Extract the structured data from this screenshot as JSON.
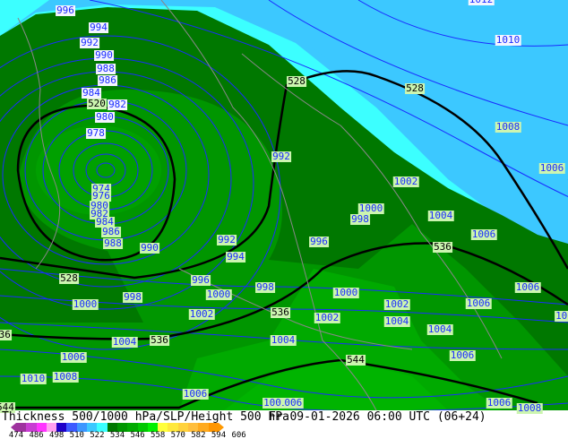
{
  "title": "Thickness 500/1000 hPa/SLP/Height 500 hPa",
  "datetime": "Fr 09-01-2026 06:00 UTC (06+24)",
  "legend": {
    "ticks": [
      "474",
      "486",
      "498",
      "510",
      "522",
      "534",
      "546",
      "558",
      "570",
      "582",
      "594",
      "606"
    ],
    "colors": [
      "#9e329e",
      "#c83cd2",
      "#ff33ff",
      "#ffa0f0",
      "#1e00c8",
      "#3c5aff",
      "#3c96ff",
      "#3cc8ff",
      "#3cffff",
      "#007800",
      "#009600",
      "#00aa00",
      "#00c800",
      "#00f000",
      "#ffff3c",
      "#ffe83c",
      "#ffd23c",
      "#ffbe3c",
      "#ffaa1e",
      "#ff9600"
    ]
  },
  "isobar_labels": [
    "996",
    "994",
    "992",
    "990",
    "988",
    "986",
    "984",
    "982",
    "980",
    "978",
    "974",
    "976",
    "980",
    "982",
    "984",
    "986",
    "988",
    "990",
    "992",
    "994",
    "996",
    "998",
    "1000",
    "1000",
    "1002",
    "1004",
    "1006",
    "1008",
    "1010",
    "1006",
    "1006",
    "992",
    "1002",
    "1000",
    "998",
    "1004",
    "1006",
    "996",
    "998",
    "1000",
    "1002",
    "1002",
    "1004",
    "1004",
    "1006",
    "1006",
    "1006",
    "1004",
    "1006",
    "1008",
    "100",
    "1006",
    "1008",
    "1010",
    "1012",
    "100"
  ],
  "thickness_labels": [
    "520",
    "528",
    "528",
    "528",
    "536",
    "536",
    "536",
    "544",
    "544",
    "536"
  ]
}
